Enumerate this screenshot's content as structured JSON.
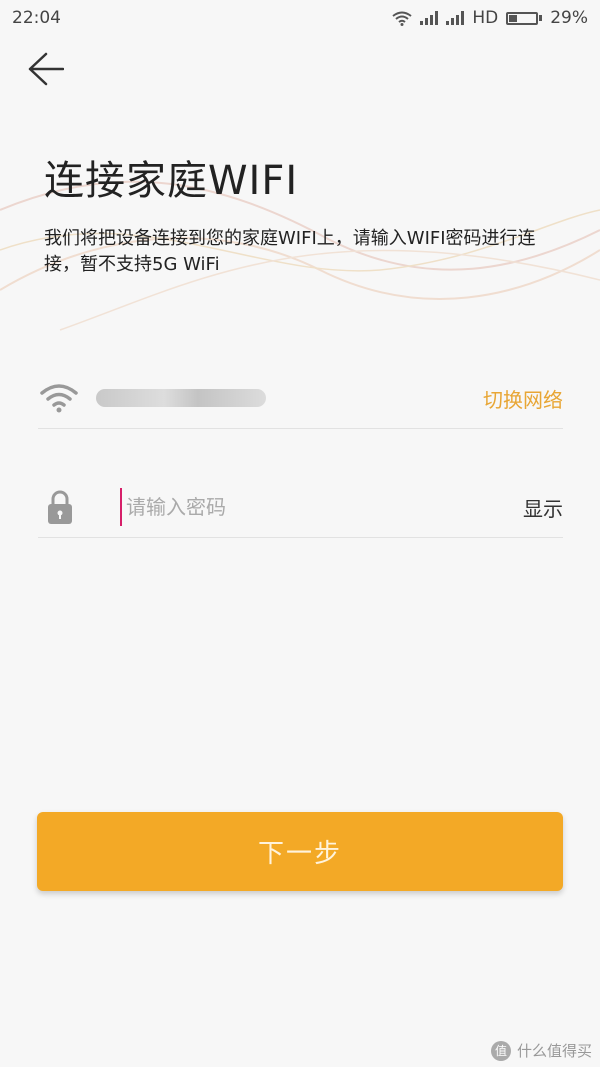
{
  "status_bar": {
    "time": "22:04",
    "network": "HD",
    "battery_percent": "29%",
    "battery_level": 0.29
  },
  "header": {
    "back_icon": "arrow-left-icon"
  },
  "title": "连接家庭WIFI",
  "description": "我们将把设备连接到您的家庭WIFI上，请输入WIFI密码进行连接，暂不支持5G WiFi",
  "wifi_row": {
    "icon": "wifi-icon",
    "switch_label": "切换网络"
  },
  "password_row": {
    "icon": "lock-icon",
    "placeholder": "请输入密码",
    "value": "",
    "show_label": "显示"
  },
  "next_button": "下一步",
  "watermark": {
    "badge": "值",
    "text": "什么值得买"
  },
  "colors": {
    "accent": "#f3a926",
    "link": "#e8a635",
    "background": "#f7f7f7",
    "cursor": "#d61f69"
  }
}
